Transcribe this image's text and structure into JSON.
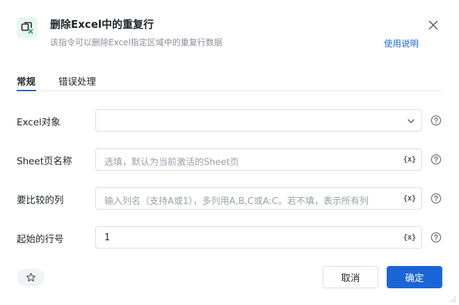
{
  "header": {
    "title": "删除Excel中的重复行",
    "subtitle": "该指令可以删除Excel指定区域中的重复行数据",
    "help_link": "使用说明"
  },
  "tabs": [
    {
      "label": "常规",
      "active": true
    },
    {
      "label": "错误处理",
      "active": false
    }
  ],
  "form": {
    "excel_object": {
      "label": "Excel对象",
      "value": ""
    },
    "sheet_name": {
      "label": "Sheet页名称",
      "placeholder": "选填，默认为当前激活的Sheet页",
      "var_button": "{x}"
    },
    "compare_columns": {
      "label": "要比较的列",
      "placeholder": "输入列名（支持A或1），多列用A,B,C或A:C。若不填，表示所有列",
      "var_button": "{x}"
    },
    "start_row": {
      "label": "起始的行号",
      "value": "1",
      "var_button": "{x}"
    }
  },
  "footer": {
    "cancel_label": "取消",
    "ok_label": "确定"
  },
  "colors": {
    "primary": "#1a66d6",
    "icon_green": "#21a366"
  }
}
